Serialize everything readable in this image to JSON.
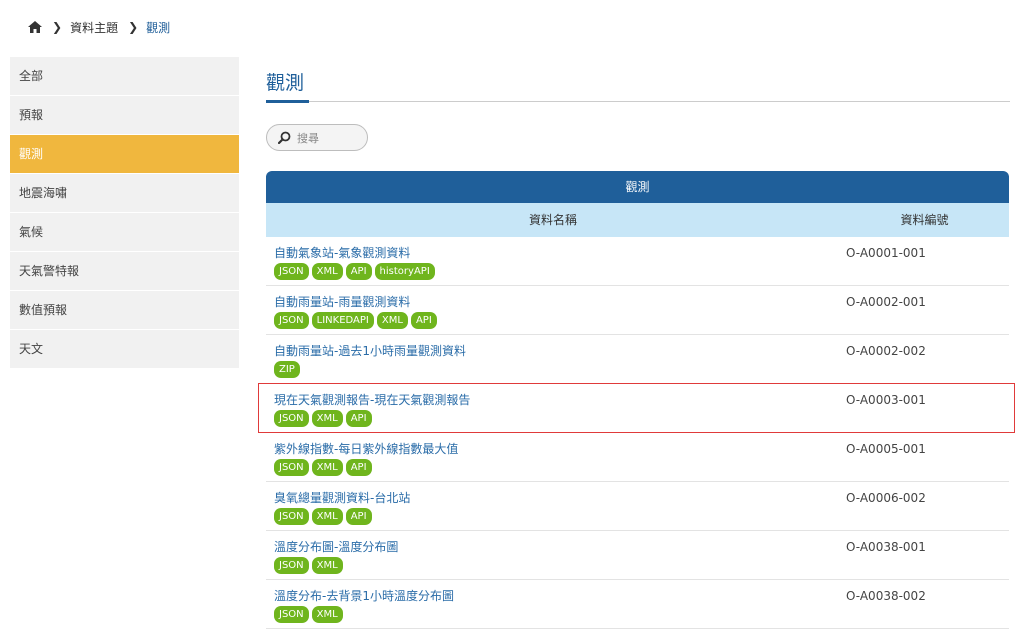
{
  "breadcrumb": {
    "home_icon": "home-icon",
    "items": [
      "資料主題",
      "觀測"
    ]
  },
  "sidebar": {
    "items": [
      {
        "label": "全部"
      },
      {
        "label": "預報"
      },
      {
        "label": "觀測",
        "active": true
      },
      {
        "label": "地震海嘯"
      },
      {
        "label": "氣候"
      },
      {
        "label": "天氣警特報"
      },
      {
        "label": "數值預報"
      },
      {
        "label": "天文"
      }
    ]
  },
  "main": {
    "title": "觀測",
    "search": {
      "placeholder": "搜尋",
      "icon": "search-icon"
    },
    "table": {
      "caption": "觀測",
      "col_name": "資料名稱",
      "col_code": "資料編號",
      "rows": [
        {
          "name": "自動氣象站-氣象觀測資料",
          "tags": [
            "JSON",
            "XML",
            "API",
            "historyAPI"
          ],
          "code": "O-A0001-001"
        },
        {
          "name": "自動雨量站-雨量觀測資料",
          "tags": [
            "JSON",
            "LINKEDAPI",
            "XML",
            "API"
          ],
          "code": "O-A0002-001"
        },
        {
          "name": "自動雨量站-過去1小時雨量觀測資料",
          "tags": [
            "ZIP"
          ],
          "code": "O-A0002-002"
        },
        {
          "name": "現在天氣觀測報告-現在天氣觀測報告",
          "tags": [
            "JSON",
            "XML",
            "API"
          ],
          "code": "O-A0003-001",
          "highlighted": true
        },
        {
          "name": "紫外線指數-每日紫外線指數最大值",
          "tags": [
            "JSON",
            "XML",
            "API"
          ],
          "code": "O-A0005-001"
        },
        {
          "name": "臭氧總量觀測資料-台北站",
          "tags": [
            "JSON",
            "XML",
            "API"
          ],
          "code": "O-A0006-002"
        },
        {
          "name": "溫度分布圖-溫度分布圖",
          "tags": [
            "JSON",
            "XML"
          ],
          "code": "O-A0038-001"
        },
        {
          "name": "溫度分布-去背景1小時溫度分布圖",
          "tags": [
            "JSON",
            "XML"
          ],
          "code": "O-A0038-002"
        }
      ]
    }
  },
  "colors": {
    "accent_blue": "#1f5f9a",
    "active_orange": "#f0b73e",
    "tag_green": "#6fb51d",
    "header_light": "#c7e6f7",
    "highlight_red": "#e03a3a"
  }
}
